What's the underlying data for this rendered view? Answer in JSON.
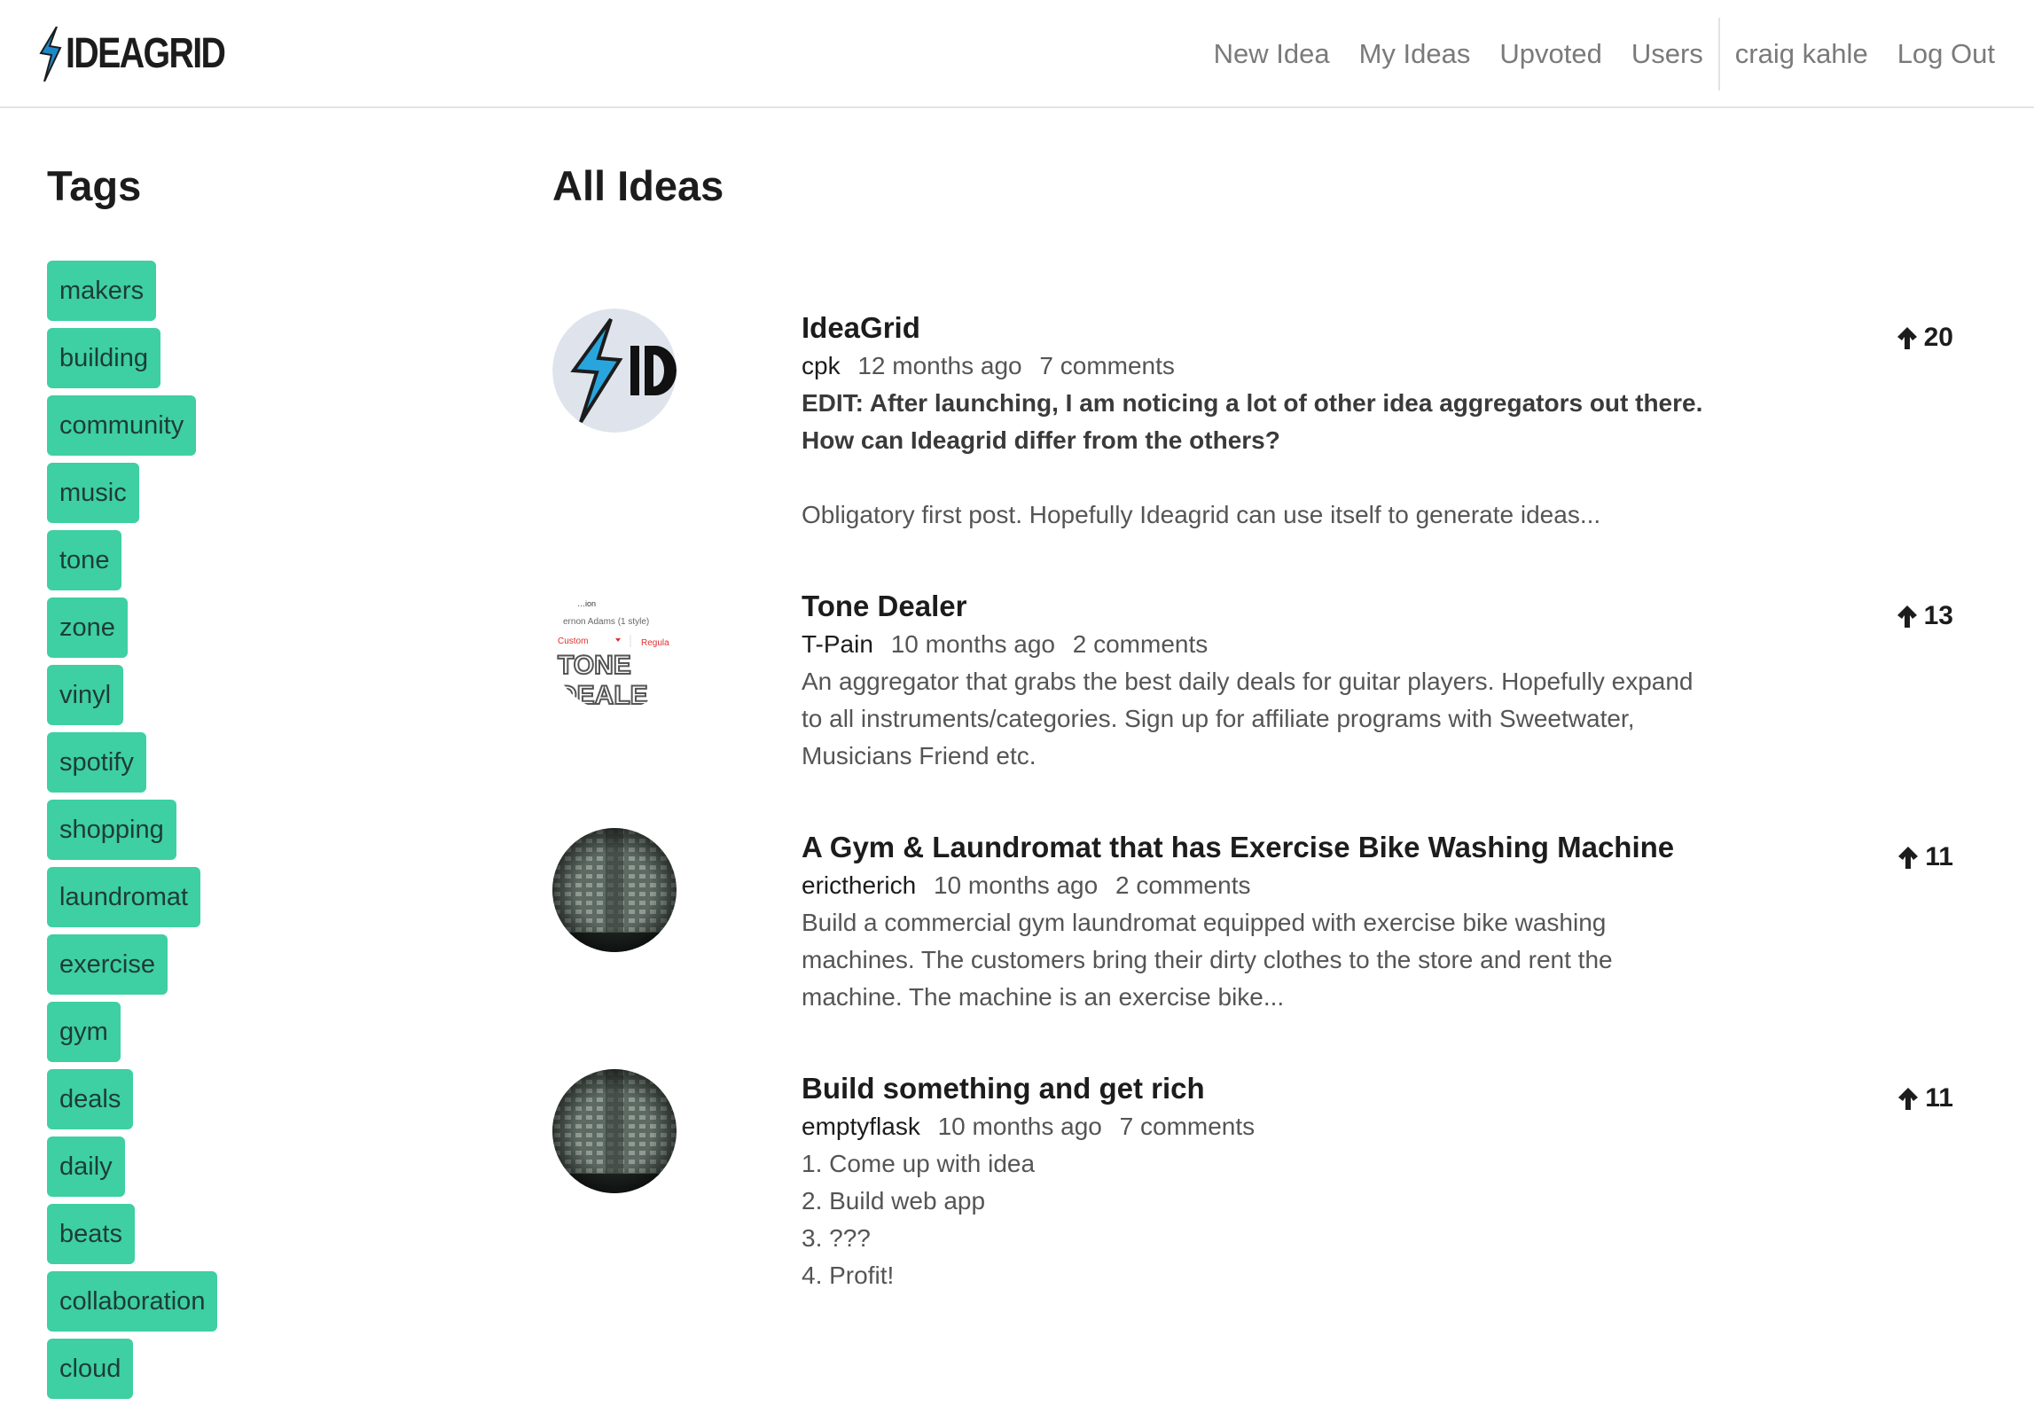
{
  "brand": {
    "name": "IDEAGRID",
    "accent": "#1e88c8"
  },
  "nav": {
    "items": [
      "New Idea",
      "My Ideas",
      "Upvoted",
      "Users"
    ],
    "user": "craig kahle",
    "logout": "Log Out"
  },
  "sidebar": {
    "title": "Tags",
    "tags": [
      "makers",
      "building",
      "community",
      "music",
      "tone",
      "zone",
      "vinyl",
      "spotify",
      "shopping",
      "laundromat",
      "exercise",
      "gym",
      "deals",
      "daily",
      "beats",
      "collaboration",
      "cloud"
    ],
    "tag_color": "#3ecfa3"
  },
  "main": {
    "title": "All Ideas",
    "ideas": [
      {
        "title": "IdeaGrid",
        "author": "cpk",
        "time": "12 months ago",
        "comments": "7 comments",
        "edit_line1": "EDIT: After launching, I am noticing a lot of other idea aggregators out there.",
        "edit_line2": "How can Ideagrid differ from the others?",
        "body": "Obligatory first post. Hopefully Ideagrid can use itself to generate ideas...",
        "votes": "20",
        "thumb": "ideagrid-logo"
      },
      {
        "title": "Tone Dealer",
        "author": "T-Pain",
        "time": "10 months ago",
        "comments": "2 comments",
        "body": "An aggregator that grabs the best daily deals for guitar players. Hopefully expand\nto all instruments/categories. Sign up for affiliate programs with Sweetwater,\nMusicians Friend etc.",
        "votes": "13",
        "thumb": "tone-dealer-logo",
        "thumb_text": {
          "top": "…ion",
          "style": "ernon Adams (1 style)",
          "custom": "Custom",
          "regular": "Regula",
          "line1": "TONE",
          "line2": "DEALE"
        }
      },
      {
        "title": "A Gym & Laundromat that has Exercise Bike Washing Machine",
        "author": "erictherich",
        "time": "10 months ago",
        "comments": "2 comments",
        "body": "Build a commercial gym laundromat equipped with exercise bike washing\nmachines. The customers bring their dirty clothes to the store and rent the\nmachine.  The machine is an exercise bike...",
        "votes": "11",
        "thumb": "building-photo"
      },
      {
        "title": "Build something and get rich",
        "author": "emptyflask",
        "time": "10 months ago",
        "comments": "7 comments",
        "body": "1. Come up with idea\n2. Build web app\n3. ???\n4. Profit!",
        "votes": "11",
        "thumb": "building-photo"
      }
    ]
  }
}
